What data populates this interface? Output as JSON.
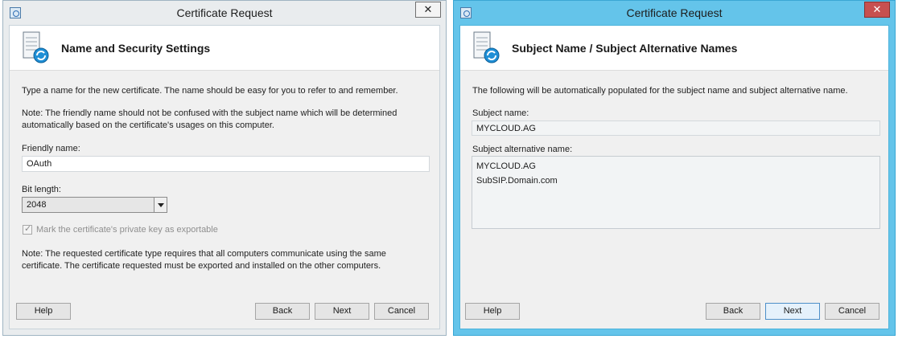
{
  "left_dialog": {
    "title": "Certificate Request",
    "close_glyph": "✕",
    "header_title": "Name and Security Settings",
    "intro": "Type a name for the new certificate. The name should be easy for you to refer to and remember.",
    "note1": "Note: The friendly name should not be confused with the subject name which will be determined automatically based on the certificate's usages on this computer.",
    "friendly_name_label": "Friendly name:",
    "friendly_name_value": "OAuth",
    "bit_length_label": "Bit length:",
    "bit_length_value": "2048",
    "export_checkbox_label": "Mark the certificate's private key as exportable",
    "export_checked": true,
    "note2": "Note: The requested certificate type requires that all computers communicate using the same certificate. The certificate requested must be exported and installed on the other computers.",
    "buttons": {
      "help": "Help",
      "back": "Back",
      "next": "Next",
      "cancel": "Cancel"
    }
  },
  "right_dialog": {
    "title": "Certificate Request",
    "close_glyph": "✕",
    "header_title": "Subject Name / Subject Alternative Names",
    "intro": "The following will be automatically populated for the subject name and subject alternative name.",
    "subject_name_label": "Subject name:",
    "subject_name_value": "MYCLOUD.AG",
    "san_label": "Subject alternative name:",
    "san_values": [
      "MYCLOUD.AG",
      "SubSIP.Domain.com"
    ],
    "buttons": {
      "help": "Help",
      "back": "Back",
      "next": "Next",
      "cancel": "Cancel"
    }
  },
  "colors": {
    "active_frame": "#64c4ea",
    "inactive_frame": "#e9ecee",
    "close_active": "#c75050",
    "default_button_border": "#4d8fc9"
  },
  "icons": [
    "app-icon",
    "certificate-wizard-icon",
    "close-icon",
    "dropdown-arrow-icon",
    "checkmark-icon"
  ]
}
